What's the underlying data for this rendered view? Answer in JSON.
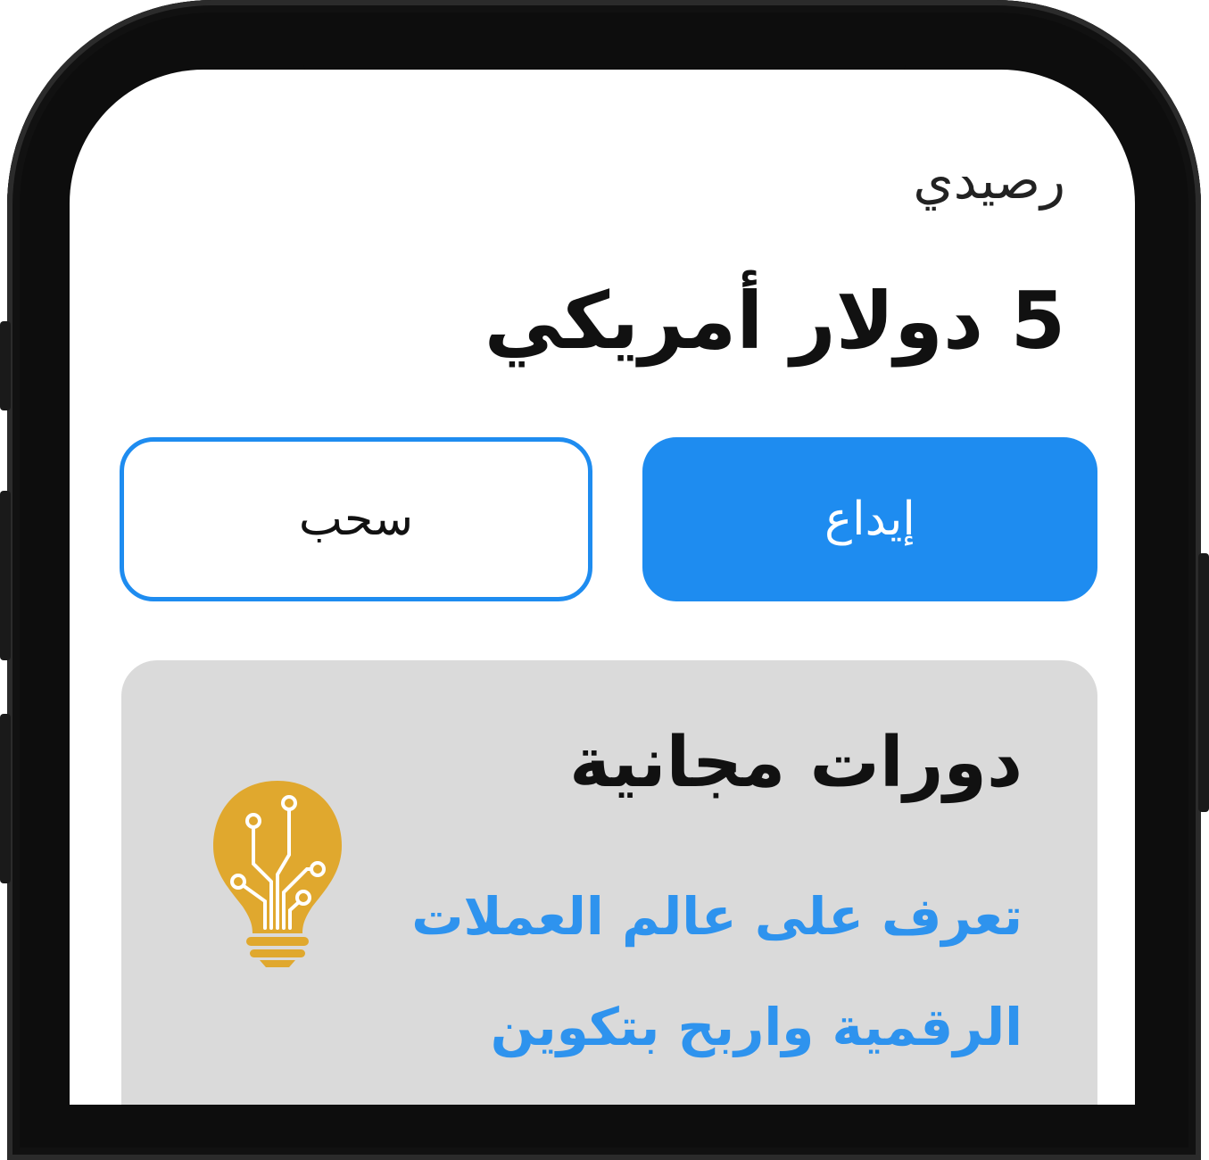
{
  "wallet": {
    "title": "رصيدي",
    "balance": "5 دولار أمريكي"
  },
  "actions": {
    "deposit_label": "إيداع",
    "withdraw_label": "سحب"
  },
  "courses_card": {
    "title": "دورات مجانية",
    "description": "تعرف على عالم العملات الرقمية واربح بتكوين",
    "icon": "lightbulb-icon"
  },
  "colors": {
    "accent": "#1e8cf0",
    "link": "#2e93ee",
    "card_bg": "#dadada",
    "bulb": "#e0a82e"
  }
}
